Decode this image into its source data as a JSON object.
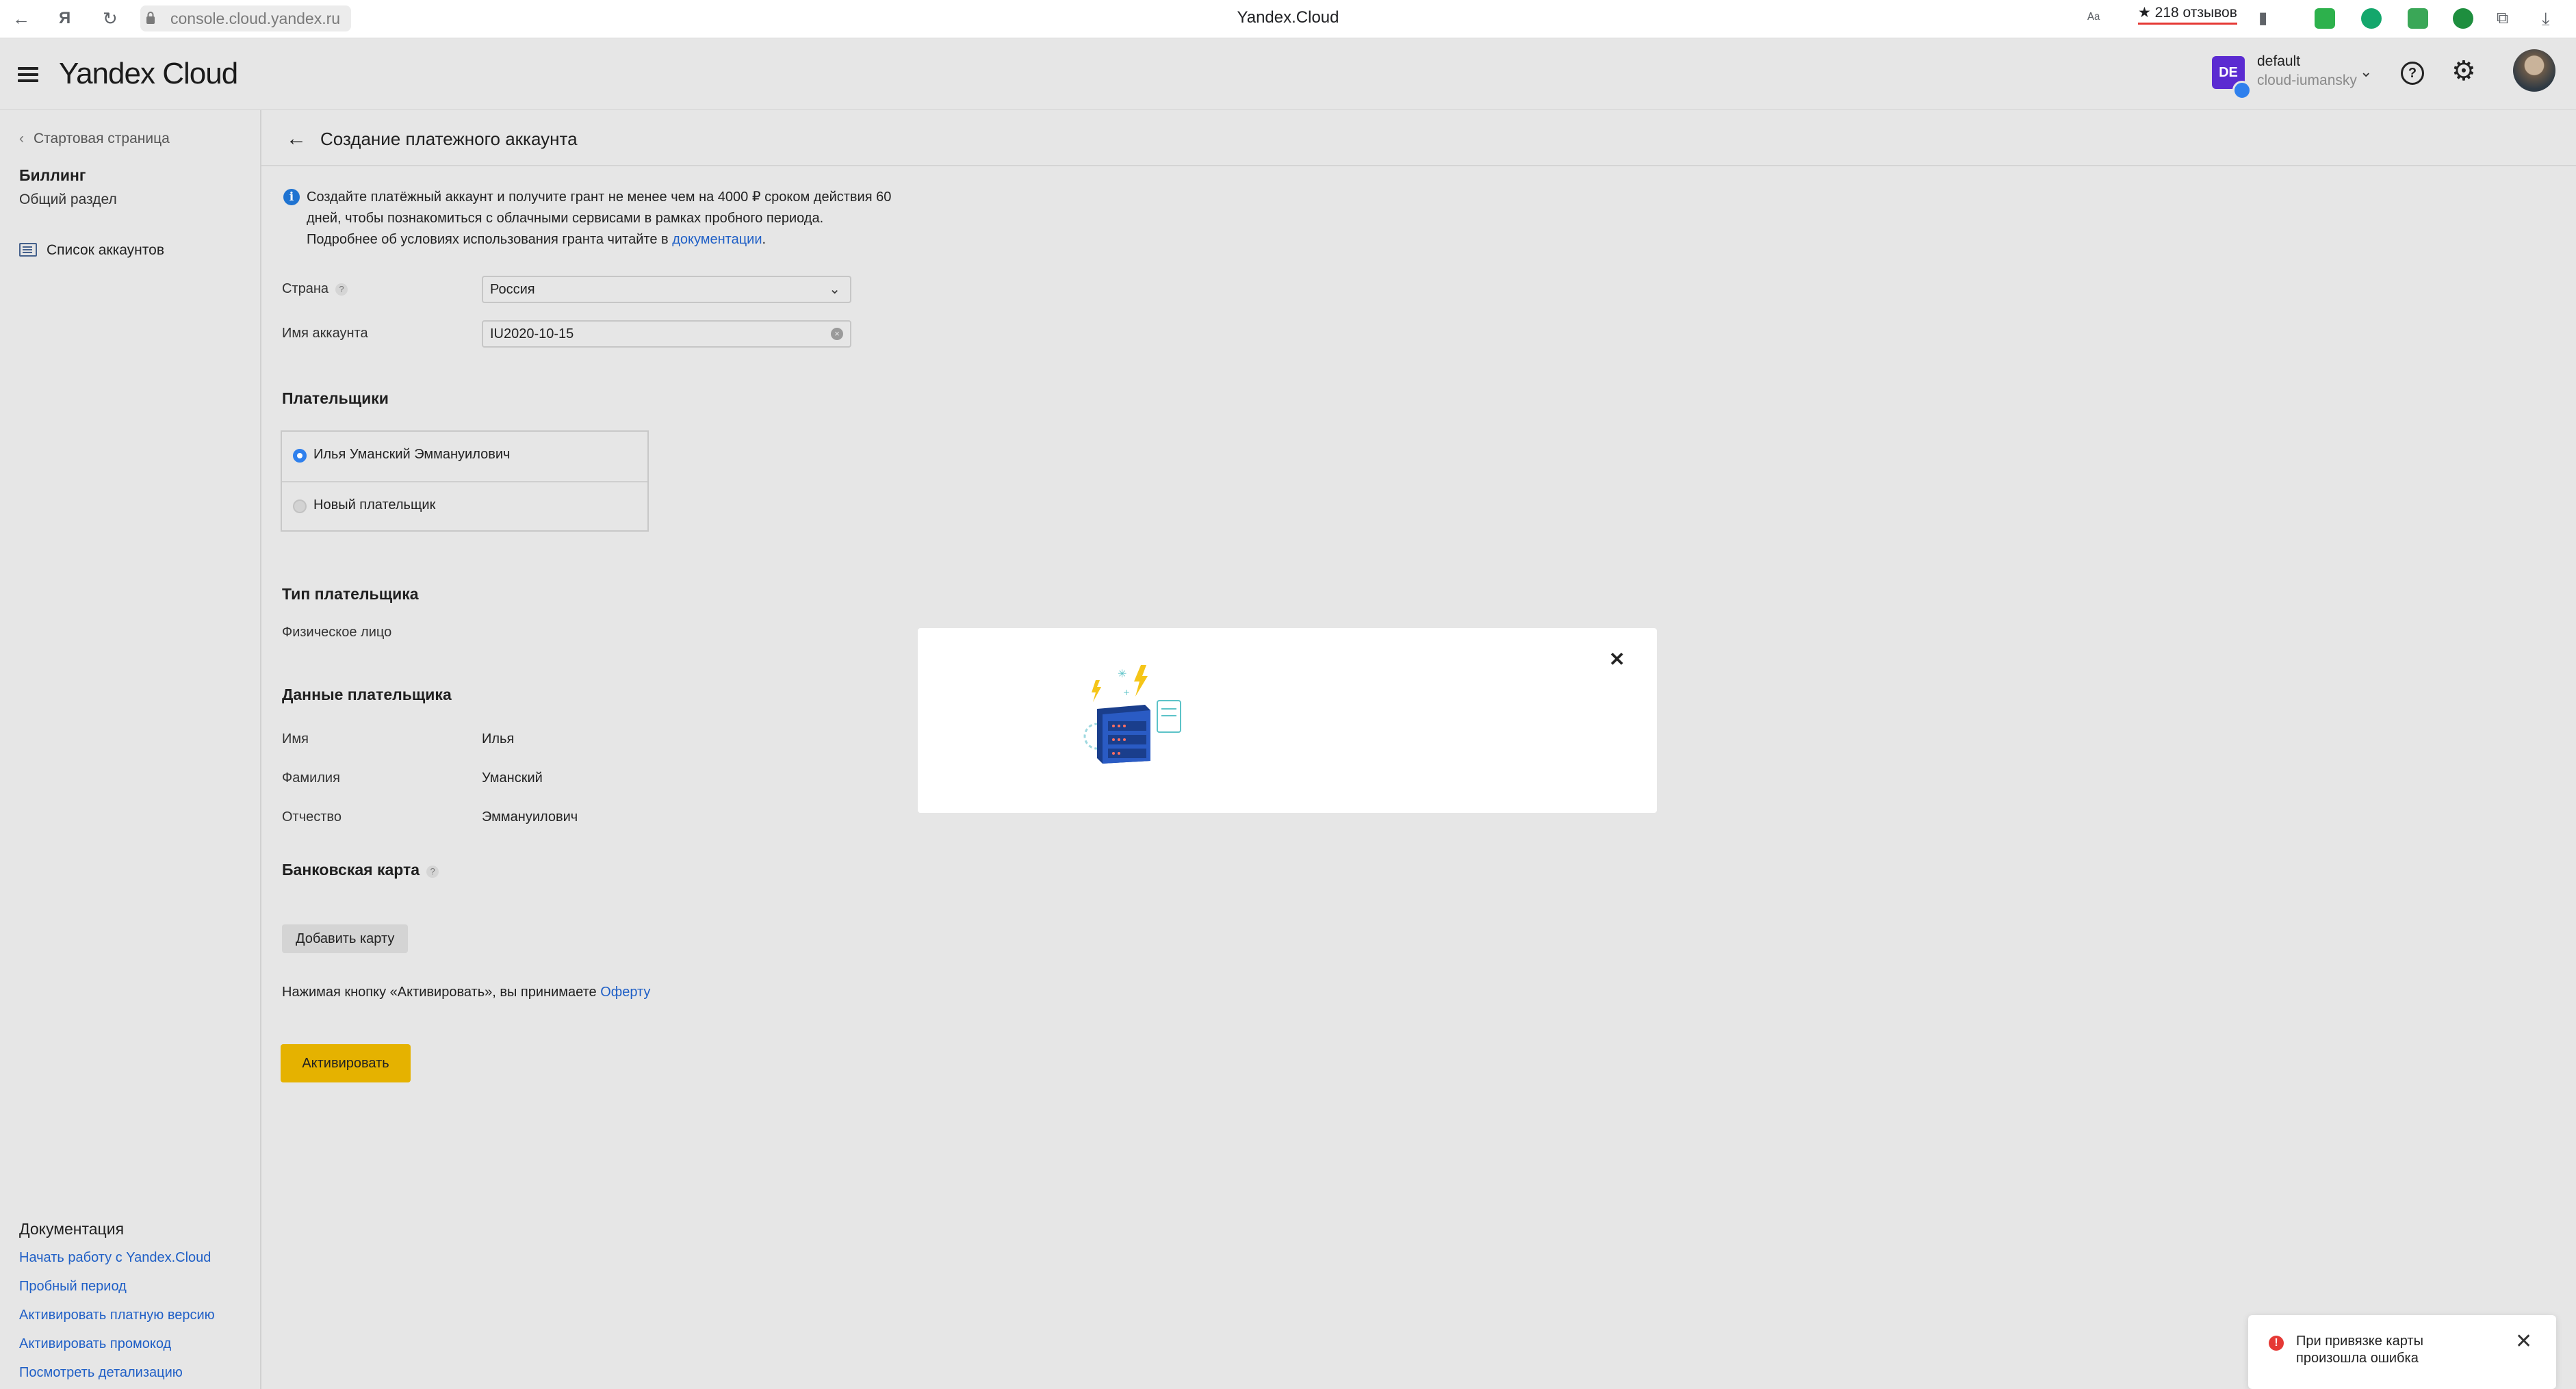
{
  "browser": {
    "back_icon": "arrow-left-icon",
    "yandex_glyph": "Я",
    "url": "console.cloud.yandex.ru",
    "tab_title": "Yandex.Cloud",
    "reviews": "★ 218 отзывов",
    "extension_colors": [
      "#2db14c",
      "#14a76c",
      "#3aa757",
      "#1e8e3e"
    ]
  },
  "header": {
    "logo_yandex": "Yandex",
    "logo_cloud": "Cloud",
    "account_initials": "DE",
    "account_name": "default",
    "cloud_name": "cloud-iumansky",
    "help_glyph": "?",
    "avatar_color": "#5b2bd1"
  },
  "sidebar": {
    "back_label": "Стартовая страница",
    "section_title": "Биллинг",
    "section_subtitle": "Общий раздел",
    "item_label": "Список аккаунтов",
    "docs_title": "Документация",
    "doc_links": [
      "Начать работу с Yandex.Cloud",
      "Пробный период",
      "Активировать платную версию",
      "Активировать промокод",
      "Посмотреть детализацию"
    ]
  },
  "main": {
    "title": "Создание платежного аккаунта",
    "info_text": "Создайте платёжный аккаунт и получите грант не менее чем на 4000 ₽ сроком действия 60 дней, чтобы познакомиться с облачными сервисами в рамках пробного периода. Подробнее об условиях использования гранта читайте в ",
    "info_link": "документации",
    "country_label": "Страна",
    "country_value": "Россия",
    "account_name_label": "Имя аккаунта",
    "account_name_value": "IU2020-10-15",
    "payers_heading": "Плательщики",
    "payers": [
      "Илья Уманский Эммануилович",
      "Новый плательщик"
    ],
    "payer_type_heading": "Тип плательщика",
    "payer_type_value": "Физическое лицо",
    "payer_data_heading": "Данные плательщика",
    "first_name_label": "Имя",
    "first_name_value": "Илья",
    "last_name_label": "Фамилия",
    "last_name_value": "Уманский",
    "patronymic_label": "Отчество",
    "patronymic_value": "Эммануилович",
    "bank_card_heading": "Банковская карта",
    "add_card_button": "Добавить карту",
    "offer_text": "Нажимая кнопку «Активировать», вы принимаете ",
    "offer_link": "Оферту",
    "activate_button": "Активировать"
  },
  "modal": {
    "close_glyph": "✕",
    "illustration": "server-rack-illustration"
  },
  "toast": {
    "text": "При привязке карты произошла ошибка",
    "close_glyph": "✕"
  }
}
